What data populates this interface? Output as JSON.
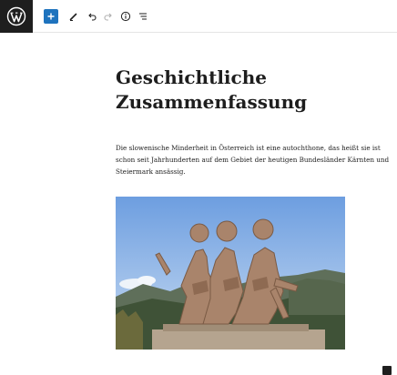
{
  "header": {
    "logo_icon": "wordpress-logo-icon",
    "tools": [
      {
        "name": "add-block",
        "icon": "plus-icon",
        "color": "#1e73be"
      },
      {
        "name": "tools",
        "icon": "pencil-icon"
      },
      {
        "name": "undo",
        "icon": "undo-icon"
      },
      {
        "name": "redo",
        "icon": "redo-icon",
        "disabled": true
      },
      {
        "name": "details",
        "icon": "info-icon"
      },
      {
        "name": "list-view",
        "icon": "list-view-icon"
      }
    ]
  },
  "post": {
    "title": "Geschichtliche Zusammenfassung",
    "paragraph": "Die slowenische Minderheit in Österreich ist eine autochthone, das heißt sie ist schon seit Jahrhunderten auf dem Gebiet der heutigen Bundesländer Kärnten und Steiermark ansässig.",
    "image": {
      "icon": "partisan-monument-image"
    }
  },
  "colors": {
    "accent": "#1e73be",
    "text": "#1e1e1e"
  }
}
